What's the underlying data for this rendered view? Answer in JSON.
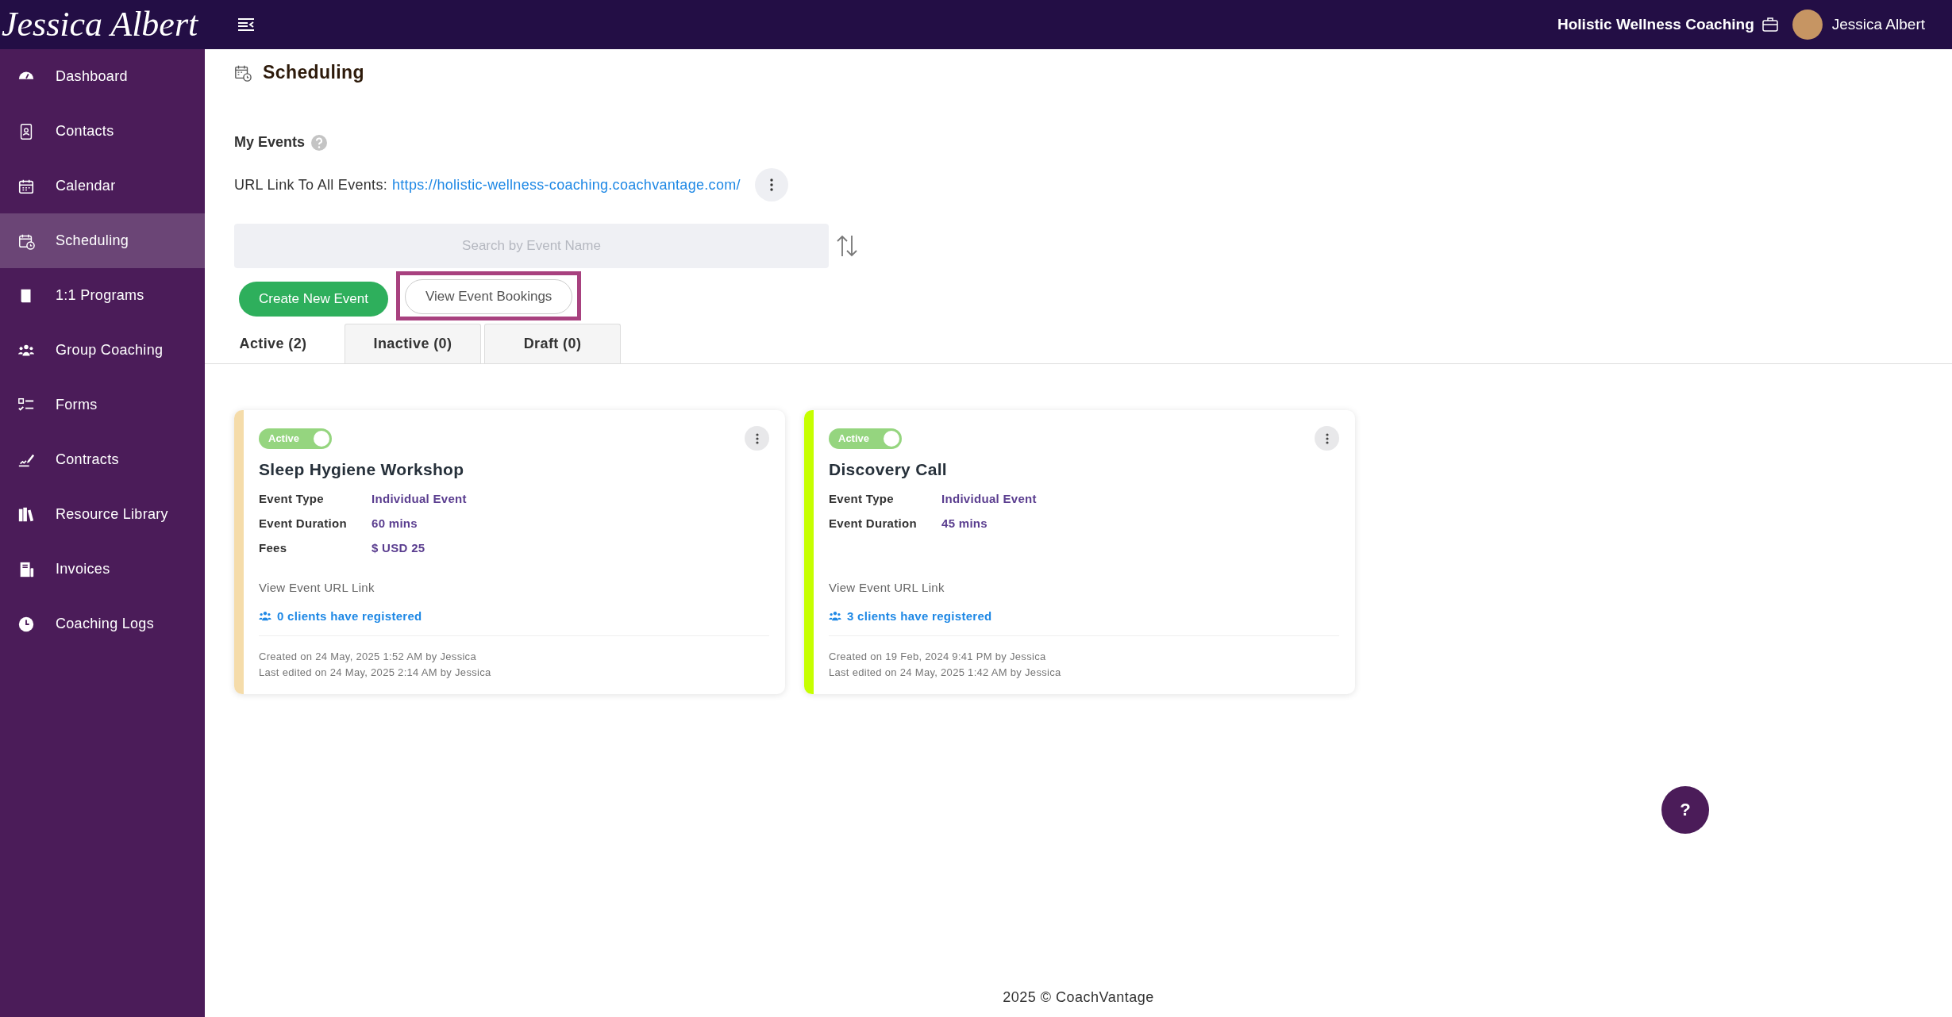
{
  "header": {
    "logo": "Jessica Albert",
    "business": "Holistic Wellness Coaching",
    "user": "Jessica Albert"
  },
  "sidebar": {
    "items": [
      {
        "label": "Dashboard",
        "selected": false
      },
      {
        "label": "Contacts",
        "selected": false
      },
      {
        "label": "Calendar",
        "selected": false
      },
      {
        "label": "Scheduling",
        "selected": true
      },
      {
        "label": "1:1 Programs",
        "selected": false
      },
      {
        "label": "Group Coaching",
        "selected": false
      },
      {
        "label": "Forms",
        "selected": false
      },
      {
        "label": "Contracts",
        "selected": false
      },
      {
        "label": "Resource Library",
        "selected": false
      },
      {
        "label": "Invoices",
        "selected": false
      },
      {
        "label": "Coaching Logs",
        "selected": false
      }
    ]
  },
  "page": {
    "title": "Scheduling",
    "section": "My Events",
    "url_label": "URL Link To All Events:",
    "url": "https://holistic-wellness-coaching.coachvantage.com/"
  },
  "search": {
    "placeholder": "Search by Event Name"
  },
  "buttons": [
    {
      "label": "Create New Event",
      "kind": "primary",
      "highlighted": false
    },
    {
      "label": "View Event Bookings",
      "kind": "outline",
      "highlighted": true
    }
  ],
  "tabs": [
    {
      "label": "Active (2)",
      "selected": true
    },
    {
      "label": "Inactive (0)",
      "selected": false
    },
    {
      "label": "Draft (0)",
      "selected": false
    }
  ],
  "events": [
    {
      "status": "Active",
      "on": true,
      "color": "#f5dcaa",
      "title": "Sleep Hygiene Workshop",
      "fields": [
        {
          "label": "Event Type",
          "value": "Individual Event"
        },
        {
          "label": "Event Duration",
          "value": "60 mins"
        },
        {
          "label": "Fees",
          "value": "$ USD 25"
        }
      ],
      "url_link": "View Event URL Link",
      "registered": "0 clients have registered",
      "created": "Created on 24 May, 2025 1:52 AM by Jessica",
      "edited": "Last edited on 24 May, 2025 2:14 AM by Jessica"
    },
    {
      "status": "Active",
      "on": true,
      "color": "#c6ff00",
      "title": "Discovery Call",
      "fields": [
        {
          "label": "Event Type",
          "value": "Individual Event"
        },
        {
          "label": "Event Duration",
          "value": "45 mins"
        }
      ],
      "url_link": "View Event URL Link",
      "registered": "3 clients have registered",
      "created": "Created on 19 Feb, 2024 9:41 PM by Jessica",
      "edited": "Last edited on 24 May, 2025 1:42 AM by Jessica"
    }
  ],
  "help": {
    "label": "?"
  },
  "footer": "2025 © CoachVantage"
}
